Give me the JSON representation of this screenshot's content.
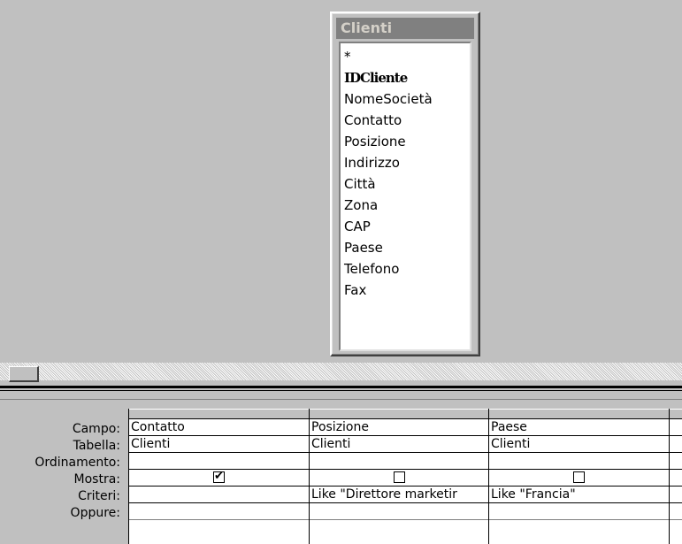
{
  "table_window": {
    "title": "Clienti",
    "fields": [
      "*",
      "IDCliente",
      "NomeSocietà",
      "Contatto",
      "Posizione",
      "Indirizzo",
      "Città",
      "Zona",
      "CAP",
      "Paese",
      "Telefono",
      "Fax"
    ],
    "primary_key": "IDCliente"
  },
  "grid": {
    "row_labels": {
      "campo": "Campo:",
      "tabella": "Tabella:",
      "ordinamento": "Ordinamento:",
      "mostra": "Mostra:",
      "criteri": "Criteri:",
      "oppure": "Oppure:"
    },
    "columns": [
      {
        "campo": "Contatto",
        "tabella": "Clienti",
        "ordinamento": "",
        "mostra": true,
        "criteri": "",
        "oppure": ""
      },
      {
        "campo": "Posizione",
        "tabella": "Clienti",
        "ordinamento": "",
        "mostra": false,
        "criteri": "Like \"Direttore marketir",
        "oppure": ""
      },
      {
        "campo": "Paese",
        "tabella": "Clienti",
        "ordinamento": "",
        "mostra": false,
        "criteri": "Like \"Francia\"",
        "oppure": ""
      },
      {
        "campo": "",
        "tabella": "",
        "ordinamento": "",
        "mostra": null,
        "criteri": "",
        "oppure": ""
      }
    ]
  }
}
